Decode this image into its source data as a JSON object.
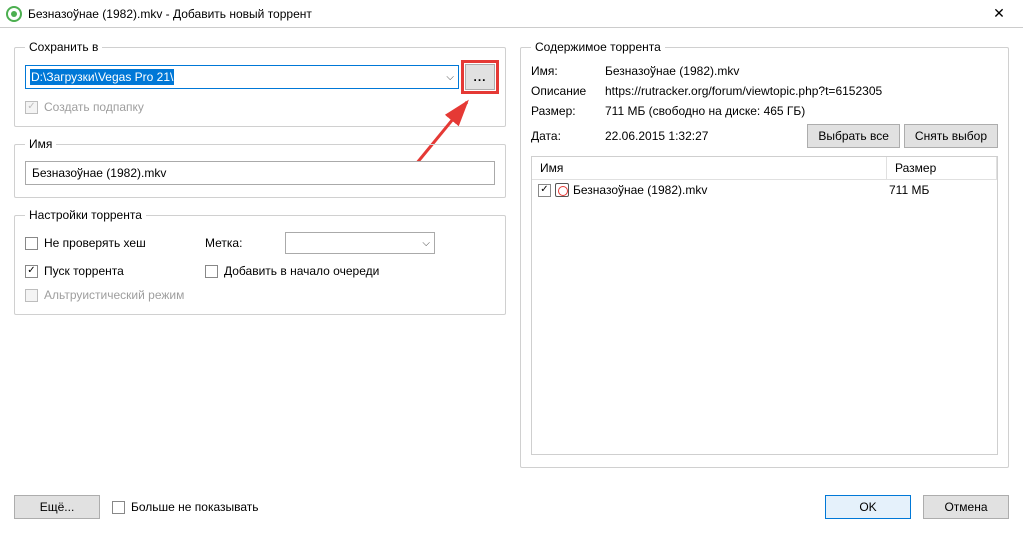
{
  "window": {
    "title": "Безназоўнае (1982).mkv - Добавить новый торрент",
    "close": "✕"
  },
  "save": {
    "legend": "Сохранить в",
    "path": "D:\\Загрузки\\Vegas Pro 21\\",
    "browse": "...",
    "subfolder_label": "Создать подпапку"
  },
  "name": {
    "legend": "Имя",
    "value": "Безназоўнае (1982).mkv"
  },
  "settings": {
    "legend": "Настройки торрента",
    "no_check_hash": "Не проверять хеш",
    "start_torrent": "Пуск торрента",
    "altruistic": "Альтруистический режим",
    "label_label": "Метка:",
    "add_front": "Добавить в начало очереди",
    "combo_value": ""
  },
  "content_group": {
    "legend": "Содержимое торрента",
    "name_label": "Имя:",
    "name_value": "Безназоўнае (1982).mkv",
    "desc_label": "Описание",
    "desc_value": "https://rutracker.org/forum/viewtopic.php?t=6152305",
    "size_label": "Размер:",
    "size_value": "711 МБ (свободно на диске: 465 ГБ)",
    "date_label": "Дата:",
    "date_value": "22.06.2015 1:32:27",
    "select_all": "Выбрать все",
    "deselect_all": "Снять выбор"
  },
  "table": {
    "col_name": "Имя",
    "col_size": "Размер",
    "rows": [
      {
        "name": "Безназоўнае (1982).mkv",
        "size": "711 МБ"
      }
    ]
  },
  "footer": {
    "more": "Ещё...",
    "dont_show": "Больше не показывать",
    "ok": "OK",
    "cancel": "Отмена"
  }
}
